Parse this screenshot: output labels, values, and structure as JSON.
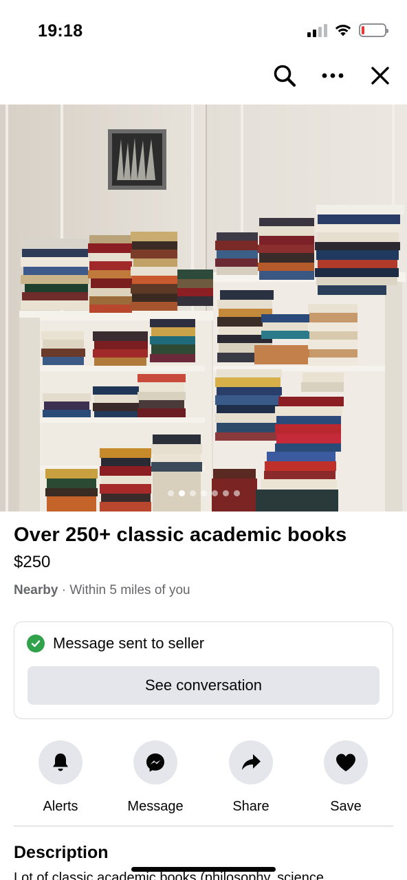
{
  "status_bar": {
    "time": "19:18",
    "battery_color": "#e53935"
  },
  "toolbar": {
    "icons": [
      "search-icon",
      "more-icon",
      "close-icon"
    ]
  },
  "gallery": {
    "photo_count": 7,
    "active_index": 1
  },
  "listing": {
    "title": "Over 250+ classic academic books",
    "price": "$250",
    "location_strong": "Nearby",
    "location_separator": " · ",
    "location_detail": "Within 5 miles of you"
  },
  "message_card": {
    "status_text": "Message sent to seller",
    "button_label": "See conversation",
    "status_color": "#31a24c"
  },
  "actions": [
    {
      "label": "Alerts",
      "icon": "bell-icon"
    },
    {
      "label": "Message",
      "icon": "messenger-icon"
    },
    {
      "label": "Share",
      "icon": "share-icon"
    },
    {
      "label": "Save",
      "icon": "heart-icon"
    }
  ],
  "description": {
    "heading": "Description",
    "text": "Lot of classic academic books (philosophy, science"
  }
}
